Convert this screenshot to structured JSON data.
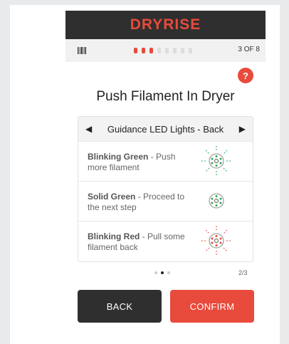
{
  "app": {
    "brand": "DRYRISE"
  },
  "status": {
    "step_text": "3 OF 8",
    "progress": {
      "current": 3,
      "total": 8
    }
  },
  "help": {
    "label": "?"
  },
  "page": {
    "title": "Push Filament In Dryer"
  },
  "guidance": {
    "title": "Guidance LED Lights - Back",
    "items": [
      {
        "strong": "Blinking Green",
        "text": " - Push more filament",
        "icon": "blinking-green-led-icon",
        "color": "#2fa84f",
        "blinking": true
      },
      {
        "strong": "Solid Green",
        "text": " - Proceed to the next step",
        "icon": "solid-green-led-icon",
        "color": "#2fa84f",
        "blinking": false
      },
      {
        "strong": "Blinking Red",
        "text": " - Pull some filament back",
        "icon": "blinking-red-led-icon",
        "color": "#e84a3b",
        "blinking": true
      }
    ]
  },
  "pager": {
    "text": "2/3",
    "current": 2,
    "total": 3
  },
  "buttons": {
    "back": "BACK",
    "confirm": "CONFIRM"
  },
  "colors": {
    "accent": "#e84a3b",
    "dark": "#2f2f2f",
    "green": "#2fa84f"
  }
}
